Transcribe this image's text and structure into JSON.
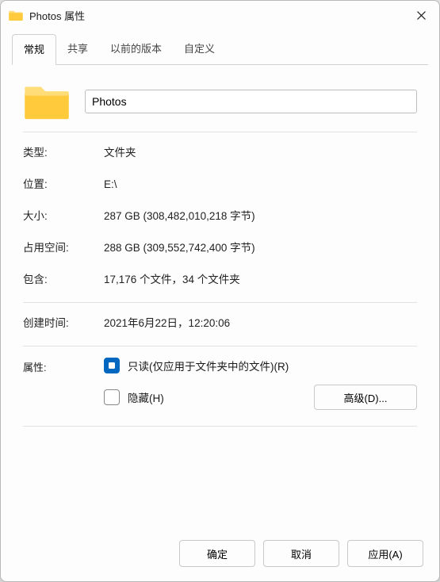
{
  "window": {
    "title": "Photos 属性"
  },
  "tabs": {
    "general": "常规",
    "share": "共享",
    "prev_versions": "以前的版本",
    "custom": "自定义"
  },
  "general": {
    "name_value": "Photos",
    "labels": {
      "type": "类型:",
      "location": "位置:",
      "size": "大小:",
      "size_on_disk": "占用空间:",
      "contains": "包含:",
      "created": "创建时间:",
      "attributes": "属性:"
    },
    "values": {
      "type": "文件夹",
      "location": "E:\\",
      "size": "287 GB (308,482,010,218 字节)",
      "size_on_disk": "288 GB (309,552,742,400 字节)",
      "contains": "17,176 个文件，34 个文件夹",
      "created": "2021年6月22日，12:20:06"
    },
    "attributes": {
      "readonly_label": "只读(仅应用于文件夹中的文件)(R)",
      "hidden_label": "隐藏(H)",
      "advanced_label": "高级(D)..."
    }
  },
  "buttons": {
    "ok": "确定",
    "cancel": "取消",
    "apply": "应用(A)"
  }
}
